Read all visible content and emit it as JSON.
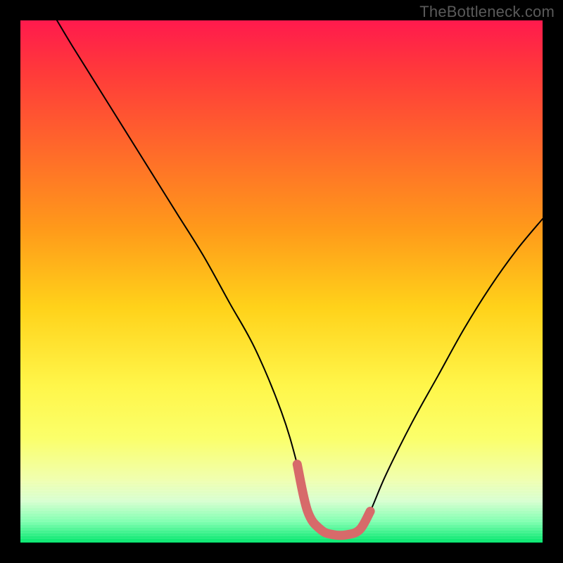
{
  "watermark": "TheBottleneck.com",
  "chart_data": {
    "type": "line",
    "title": "",
    "xlabel": "",
    "ylabel": "",
    "xlim": [
      0,
      100
    ],
    "ylim": [
      0,
      100
    ],
    "grid": false,
    "legend": false,
    "series": [
      {
        "name": "bottleneck-curve",
        "color": "#000000",
        "x": [
          7,
          10,
          15,
          20,
          25,
          30,
          35,
          40,
          45,
          50,
          53,
          55,
          57.5,
          60,
          62.5,
          65,
          67,
          70,
          75,
          80,
          85,
          90,
          95,
          100
        ],
        "values": [
          100,
          95,
          87,
          79,
          71,
          63,
          55,
          46,
          37,
          25,
          15,
          6,
          2.5,
          1.5,
          1.5,
          2.5,
          6,
          13,
          23,
          32,
          41,
          49,
          56,
          62
        ]
      },
      {
        "name": "bottom-highlight",
        "color": "#d76a6a",
        "thick": true,
        "x": [
          53,
          55,
          57.5,
          60,
          62.5,
          65,
          67
        ],
        "values": [
          15,
          6,
          2.5,
          1.5,
          1.5,
          2.5,
          6
        ]
      }
    ],
    "background_gradient": {
      "top": "#ff1a4d",
      "mid": "#ffd21a",
      "bottom": "#00e66b"
    }
  }
}
